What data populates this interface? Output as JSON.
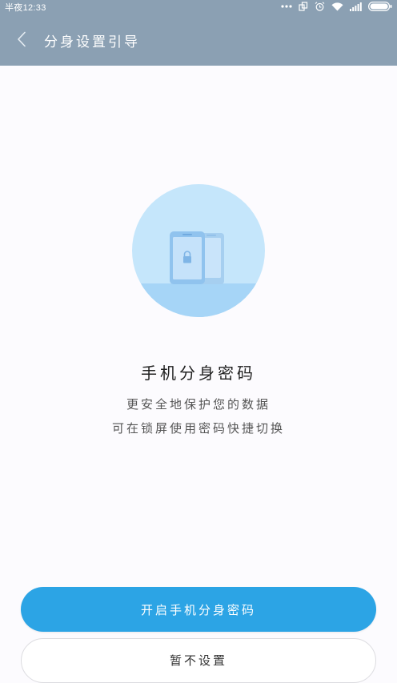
{
  "status_bar": {
    "time": "半夜12:33",
    "icons": [
      "more-icon",
      "clone-icon",
      "alarm-icon",
      "wifi-icon",
      "signal-icon",
      "battery-icon"
    ]
  },
  "header": {
    "back_icon": "chevron-left-icon",
    "title": "分身设置引导"
  },
  "hero": {
    "icon": "dual-phone-lock-icon"
  },
  "content": {
    "heading": "手机分身密码",
    "desc_line1": "更安全地保护您的数据",
    "desc_line2": "可在锁屏使用密码快捷切换"
  },
  "actions": {
    "primary_label": "开启手机分身密码",
    "secondary_label": "暂不设置"
  },
  "colors": {
    "header_bg": "#8ba0b3",
    "page_bg": "#fcfbfe",
    "primary": "#2ca4e5",
    "hero_circle": "#c5e6fb"
  }
}
